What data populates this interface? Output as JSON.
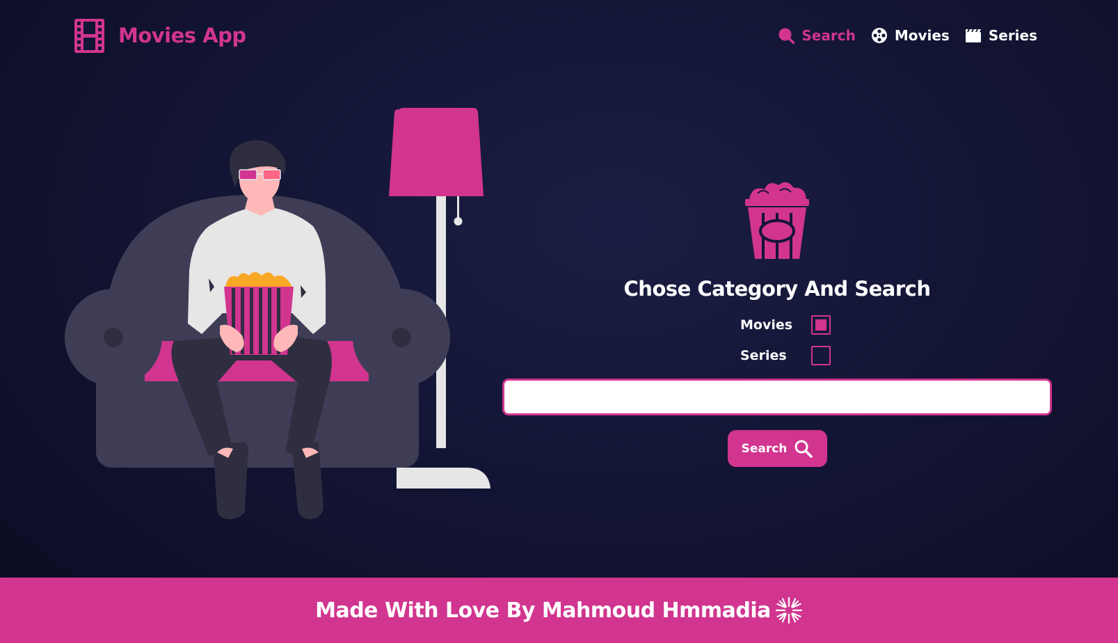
{
  "header": {
    "brand_icon": "film-strip-icon",
    "brand_title": "Movies App",
    "nav": [
      {
        "label": "Search",
        "icon": "search-icon",
        "active": true
      },
      {
        "label": "Movies",
        "icon": "film-reel-icon",
        "active": false
      },
      {
        "label": "Series",
        "icon": "clapperboard-icon",
        "active": false
      }
    ]
  },
  "panel": {
    "icon": "popcorn-icon",
    "title": "Chose Category And Search",
    "categories": [
      {
        "label": "Movies",
        "checked": true
      },
      {
        "label": "Series",
        "checked": false
      }
    ],
    "search_value": "",
    "search_button_label": "Search"
  },
  "footer": {
    "text": "Made With Love By Mahmoud Hmmadia",
    "icon": "starburst-icon"
  },
  "colors": {
    "accent": "#d1358f",
    "background": "#131534",
    "sofa": "#3f3d56",
    "lamp_pole": "#e6e6e6"
  }
}
